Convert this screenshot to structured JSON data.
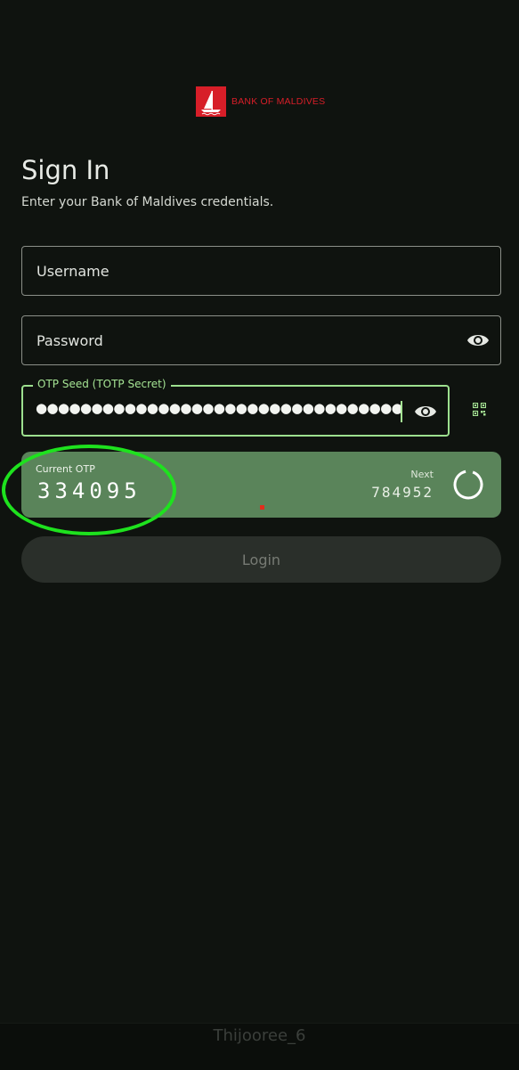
{
  "brand": {
    "name": "BANK OF MALDIVES",
    "color": "#d71e28"
  },
  "header": {
    "title": "Sign In",
    "subtitle": "Enter your Bank of Maldives credentials."
  },
  "form": {
    "username": {
      "placeholder": "Username",
      "value": ""
    },
    "password": {
      "placeholder": "Password",
      "value": "",
      "toggle_icon": "eye-icon"
    },
    "otp_seed": {
      "label": "OTP Seed (TOTP Secret)",
      "masked_value": "●●●●●●●●●●●●●●●●●●●●●●●●●●●●●●●●●●●●●●●●●●●",
      "toggle_icon": "eye-icon",
      "accent": "#9de08f"
    },
    "qr_icon": "qr-code-icon"
  },
  "otp": {
    "current_label": "Current OTP",
    "current_code": "334095",
    "next_label": "Next",
    "next_code": "784952",
    "card_color": "#5a845a"
  },
  "login_button": {
    "label": "Login"
  },
  "watermark": "Thijooree_6"
}
